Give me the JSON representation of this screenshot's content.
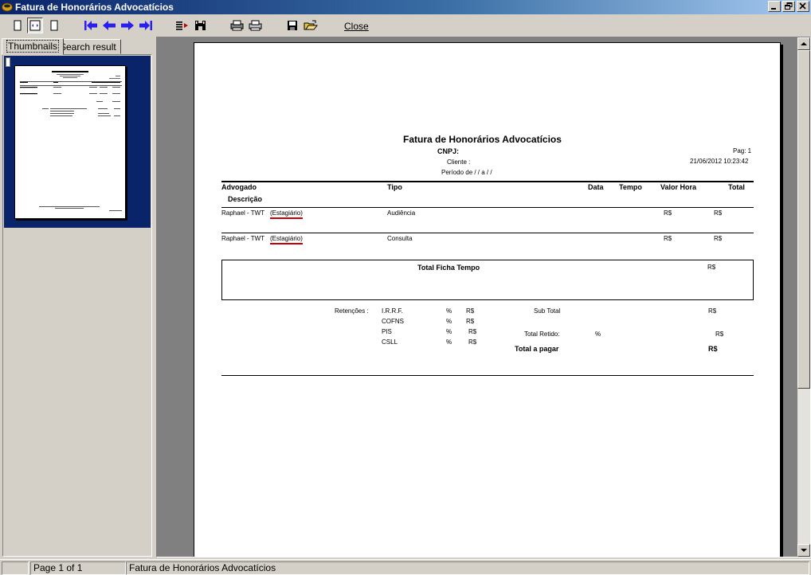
{
  "window": {
    "title": "Fatura de Honorários Advocatícios",
    "title_color": "#0a246a"
  },
  "toolbar": {
    "close_label": "Close"
  },
  "tabs": [
    {
      "label": "Thumbnails"
    },
    {
      "label": "Search result"
    }
  ],
  "report": {
    "title": "Fatura de Honorários Advocatícios",
    "cnpj_label": "CNPJ:",
    "cliente_label": "Cliente :",
    "periodo_label": "Período de  /  /    a   /  /",
    "pag_label": "Pag: 1",
    "datetime": "21/06/2012 10:23:42",
    "columns": {
      "advogado": "Advogado",
      "descricao": "Descrição",
      "tipo": "Tipo",
      "data": "Data",
      "tempo": "Tempo",
      "valor_hora": "Valor Hora",
      "total": "Total"
    },
    "rows": [
      {
        "advogado": "Raphael - TWT",
        "categoria": "(Estagiário)",
        "tipo": "Audiência",
        "valor_hora": "R$",
        "total": "R$"
      },
      {
        "advogado": "Raphael - TWT",
        "categoria": "(Estagiário)",
        "tipo": "Consulta",
        "valor_hora": "R$",
        "total": "R$"
      }
    ],
    "total_ficha_tempo_label": "Total Ficha Tempo",
    "total_ficha_tempo_value": "R$",
    "retencoes_label": "Retenções :",
    "retencoes": [
      {
        "name": "I.R.R.F.",
        "pct": "%",
        "value": "R$"
      },
      {
        "name": "COFNS",
        "pct": "%",
        "value": "R$"
      },
      {
        "name": "PIS",
        "pct": "%",
        "value": "R$"
      },
      {
        "name": "CSLL",
        "pct": "%",
        "value": "R$"
      }
    ],
    "sub_total_label": "Sub Total",
    "sub_total_value": "R$",
    "total_retido_label": "Total Retido:",
    "total_retido_pct": "%",
    "total_retido_value": "R$",
    "total_pagar_label": "Total a pagar",
    "total_pagar_value": "R$"
  },
  "status": {
    "page_label": "Page 1 of 1",
    "doc_label": "Fatura de Honorários Advocatícios"
  },
  "colors": {
    "spell_underline": "#cc0000",
    "nav_arrows": "#2a1ef0",
    "selection": "#0a246a"
  }
}
